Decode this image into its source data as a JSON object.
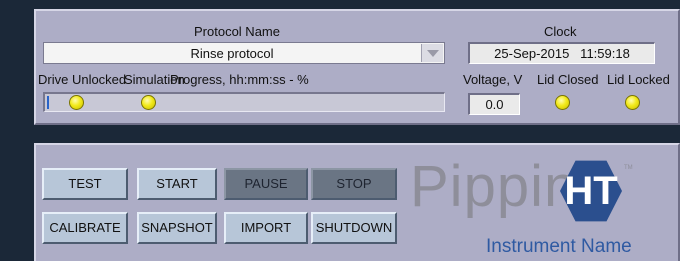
{
  "top": {
    "protocol_label": "Protocol Name",
    "protocol_value": "Rinse protocol",
    "clock_label": "Clock",
    "clock_value": "25-Sep-2015   11:59:18",
    "drive_unlocked_label": "Drive Unlocked",
    "simulation_label": "Simulation",
    "progress_label": "Progress, hh:mm:ss - %",
    "progress_fraction": 0.005,
    "voltage_label": "Voltage, V",
    "voltage_value": "0.0",
    "lid_closed_label": "Lid Closed",
    "lid_locked_label": "Lid Locked"
  },
  "buttons": {
    "test": "TEST",
    "start": "START",
    "pause": "PAUSE",
    "stop": "STOP",
    "calibrate": "CALIBRATE",
    "snapshot": "SNAPSHOT",
    "import": "IMPORT",
    "shutdown": "SHUTDOWN"
  },
  "brand": {
    "logo_word": "Pippin",
    "logo_suffix": "HT",
    "trademark": "TM",
    "instrument_name": "Instrument Name"
  },
  "colors": {
    "panel": "#adadc6",
    "led_on": "#f2ea1a",
    "button": "#b7c6d8",
    "button_disabled": "#6a7584",
    "brand_blue": "#2b4f8e"
  }
}
